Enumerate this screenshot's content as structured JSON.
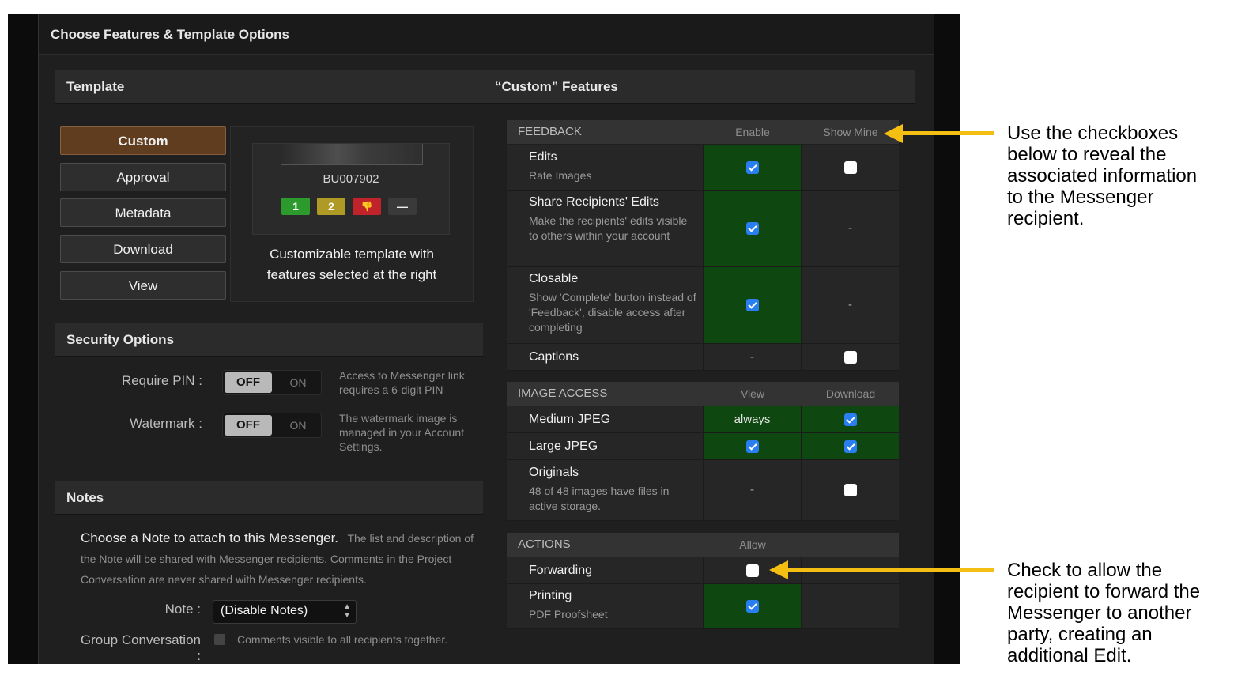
{
  "header": {
    "title": "Choose Features & Template Options"
  },
  "template": {
    "heading": "Template",
    "buttons": [
      "Custom",
      "Approval",
      "Metadata",
      "Download",
      "View"
    ],
    "selected": "Custom",
    "preview": {
      "image_code": "BU007902",
      "ratings": [
        "1",
        "2",
        "👎",
        "—"
      ],
      "caption_line1": "Customizable template with",
      "caption_line2": "features selected at the right"
    }
  },
  "security": {
    "heading": "Security Options",
    "pin": {
      "label": "Require PIN :",
      "off": "OFF",
      "on": "ON",
      "desc": "Access to Messenger link requires a 6-digit PIN"
    },
    "watermark": {
      "label": "Watermark :",
      "off": "OFF",
      "on": "ON",
      "desc": "The watermark image is managed in your Account Settings."
    }
  },
  "notes": {
    "heading": "Notes",
    "lead": "Choose a Note to attach to this Messenger.",
    "desc": "The list and description of the Note will be shared with Messenger recipients. Comments in the Project Conversation are never shared with Messenger recipients.",
    "note_label": "Note :",
    "note_value": "(Disable Notes)",
    "group_label": "Group Conversation :",
    "group_desc": "Comments visible to all recipients together."
  },
  "custom_features": {
    "heading": "“Custom” Features",
    "feedback": {
      "title": "FEEDBACK",
      "col1": "Enable",
      "col2": "Show Mine",
      "rows": [
        {
          "name": "Edits",
          "desc": "Rate Images"
        },
        {
          "name": "Share Recipients' Edits",
          "desc": "Make the recipients' edits visible to others within your account"
        },
        {
          "name": "Closable",
          "desc": "Show 'Complete' button instead of 'Feedback', disable access after completing"
        },
        {
          "name": "Captions",
          "desc": ""
        }
      ],
      "dash": "-"
    },
    "image_access": {
      "title": "IMAGE ACCESS",
      "col1": "View",
      "col2": "Download",
      "rows": [
        {
          "name": "Medium JPEG",
          "desc": "",
          "view": "always"
        },
        {
          "name": "Large JPEG",
          "desc": ""
        },
        {
          "name": "Originals",
          "desc": "48 of 48 images have files in active storage."
        }
      ]
    },
    "actions": {
      "title": "ACTIONS",
      "col1": "Allow",
      "rows": [
        {
          "name": "Forwarding",
          "desc": ""
        },
        {
          "name": "Printing",
          "desc": "PDF Proofsheet"
        }
      ]
    }
  },
  "annotations": {
    "top": [
      "Use the checkboxes",
      "below to reveal the",
      "associated information",
      "to the Messenger",
      "recipient."
    ],
    "bottom": [
      "Check to allow the",
      "recipient to forward the",
      "Messenger to another",
      "party, creating an",
      "additional Edit."
    ]
  },
  "colors": {
    "accent_brown": "#5f3d1e",
    "enabled_green": "#0f4711",
    "checkbox_blue": "#2a7ff0",
    "arrow_yellow": "#f5be12"
  }
}
